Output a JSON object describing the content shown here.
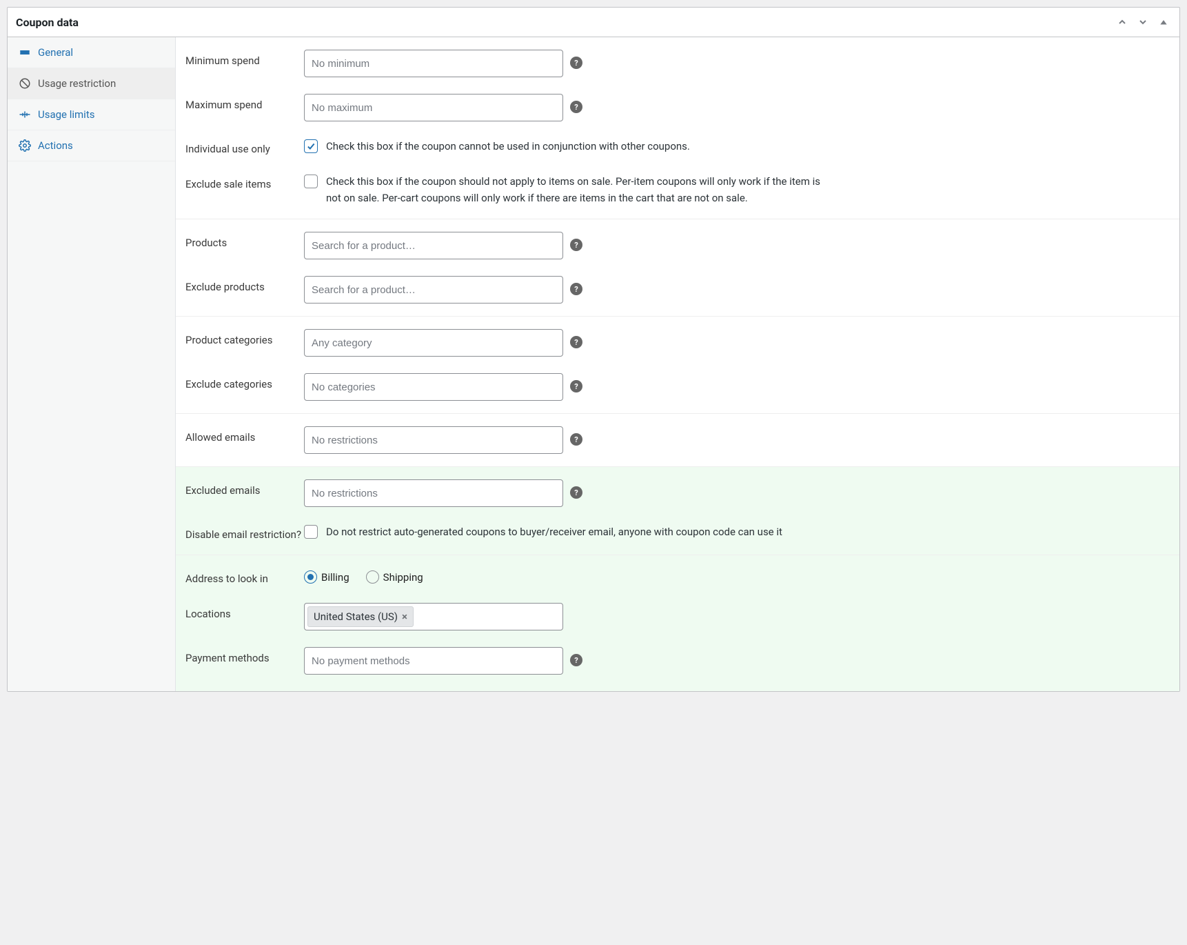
{
  "panel": {
    "title": "Coupon data"
  },
  "sidebar": {
    "items": [
      {
        "label": "General"
      },
      {
        "label": "Usage restriction"
      },
      {
        "label": "Usage limits"
      },
      {
        "label": "Actions"
      }
    ]
  },
  "fields": {
    "min_spend": {
      "label": "Minimum spend",
      "placeholder": "No minimum"
    },
    "max_spend": {
      "label": "Maximum spend",
      "placeholder": "No maximum"
    },
    "individual_use": {
      "label": "Individual use only",
      "desc": "Check this box if the coupon cannot be used in conjunction with other coupons.",
      "checked": true
    },
    "exclude_sale": {
      "label": "Exclude sale items",
      "desc": "Check this box if the coupon should not apply to items on sale. Per-item coupons will only work if the item is not on sale. Per-cart coupons will only work if there are items in the cart that are not on sale.",
      "checked": false
    },
    "products": {
      "label": "Products",
      "placeholder": "Search for a product…"
    },
    "exclude_products": {
      "label": "Exclude products",
      "placeholder": "Search for a product…"
    },
    "product_categories": {
      "label": "Product categories",
      "placeholder": "Any category"
    },
    "exclude_categories": {
      "label": "Exclude categories",
      "placeholder": "No categories"
    },
    "allowed_emails": {
      "label": "Allowed emails",
      "placeholder": "No restrictions"
    },
    "excluded_emails": {
      "label": "Excluded emails",
      "placeholder": "No restrictions"
    },
    "disable_email": {
      "label": "Disable email restriction?",
      "desc": "Do not restrict auto-generated coupons to buyer/receiver email, anyone with coupon code can use it",
      "checked": false
    },
    "address_lookin": {
      "label": "Address to look in",
      "options": [
        "Billing",
        "Shipping"
      ],
      "selected": "Billing"
    },
    "locations": {
      "label": "Locations",
      "tags": [
        "United States (US)"
      ]
    },
    "payment_methods": {
      "label": "Payment methods",
      "placeholder": "No payment methods"
    }
  }
}
